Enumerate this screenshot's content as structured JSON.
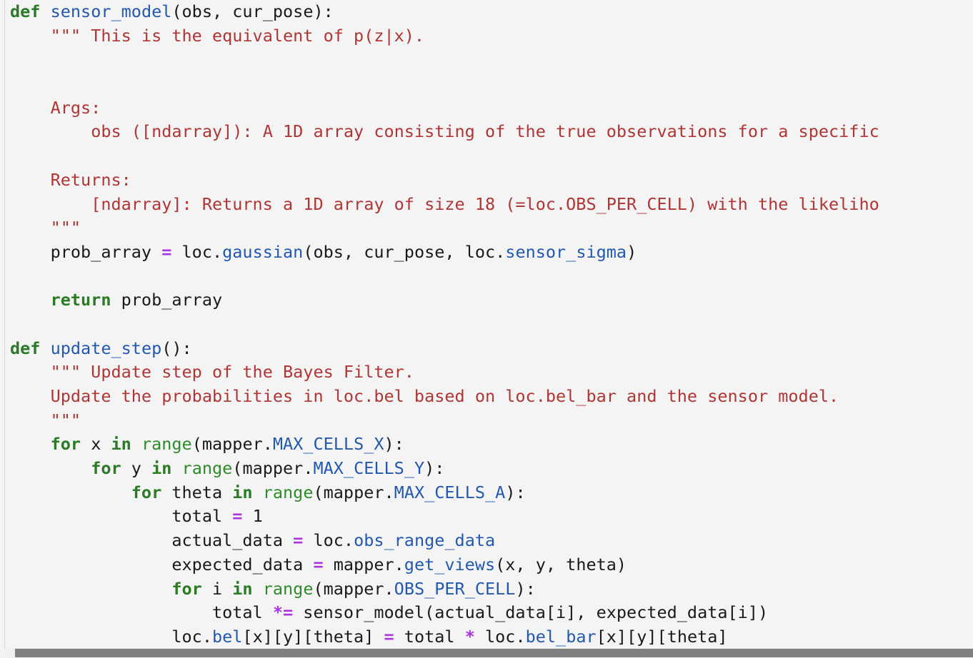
{
  "editor": {
    "language": "python",
    "background_color": "#f4f4f4",
    "text_color": "#1a1a1a",
    "colors": {
      "keyword": "#2a7a26",
      "builtin": "#2f8a2a",
      "function": "#2358b0",
      "attribute": "#2358b0",
      "string": "#b03535",
      "operator": "#aa35e0",
      "gutter_rule": "#d8d8d8",
      "scrollbar_thumb": "#808080",
      "scrollbar_track": "#f0f0f0"
    }
  },
  "scrollbar": {
    "orientation": "horizontal",
    "position": "bottom"
  },
  "code": {
    "lines": [
      {
        "indent": 0,
        "tokens": [
          {
            "t": "kw",
            "s": "def"
          },
          {
            "t": "pl",
            "s": " "
          },
          {
            "t": "fn",
            "s": "sensor_model"
          },
          {
            "t": "pl",
            "s": "(obs, cur_pose):"
          }
        ]
      },
      {
        "indent": 4,
        "tokens": [
          {
            "t": "str",
            "s": "\"\"\" This is the equivalent of p(z|x)."
          }
        ]
      },
      {
        "indent": 0,
        "tokens": []
      },
      {
        "indent": 0,
        "tokens": []
      },
      {
        "indent": 4,
        "tokens": [
          {
            "t": "str",
            "s": "Args:"
          }
        ]
      },
      {
        "indent": 8,
        "tokens": [
          {
            "t": "str",
            "s": "obs ([ndarray]): A 1D array consisting of the true observations for a specific"
          }
        ]
      },
      {
        "indent": 0,
        "tokens": []
      },
      {
        "indent": 4,
        "tokens": [
          {
            "t": "str",
            "s": "Returns:"
          }
        ]
      },
      {
        "indent": 8,
        "tokens": [
          {
            "t": "str",
            "s": "[ndarray]: Returns a 1D array of size 18 (=loc.OBS_PER_CELL) with the likeliho"
          }
        ]
      },
      {
        "indent": 4,
        "tokens": [
          {
            "t": "str",
            "s": "\"\"\""
          }
        ]
      },
      {
        "indent": 4,
        "tokens": [
          {
            "t": "pl",
            "s": "prob_array "
          },
          {
            "t": "op",
            "s": "="
          },
          {
            "t": "pl",
            "s": " loc."
          },
          {
            "t": "fn",
            "s": "gaussian"
          },
          {
            "t": "pl",
            "s": "(obs, cur_pose, loc."
          },
          {
            "t": "attr",
            "s": "sensor_sigma"
          },
          {
            "t": "pl",
            "s": ")"
          }
        ]
      },
      {
        "indent": 0,
        "tokens": []
      },
      {
        "indent": 4,
        "tokens": [
          {
            "t": "kw",
            "s": "return"
          },
          {
            "t": "pl",
            "s": " prob_array"
          }
        ]
      },
      {
        "indent": 0,
        "tokens": []
      },
      {
        "indent": 0,
        "tokens": [
          {
            "t": "kw",
            "s": "def"
          },
          {
            "t": "pl",
            "s": " "
          },
          {
            "t": "fn",
            "s": "update_step"
          },
          {
            "t": "pl",
            "s": "():"
          }
        ]
      },
      {
        "indent": 4,
        "tokens": [
          {
            "t": "str",
            "s": "\"\"\" Update step of the Bayes Filter."
          }
        ]
      },
      {
        "indent": 4,
        "tokens": [
          {
            "t": "str",
            "s": "Update the probabilities in loc.bel based on loc.bel_bar and the sensor model."
          }
        ]
      },
      {
        "indent": 4,
        "tokens": [
          {
            "t": "str",
            "s": "\"\"\""
          }
        ]
      },
      {
        "indent": 4,
        "tokens": [
          {
            "t": "kw",
            "s": "for"
          },
          {
            "t": "pl",
            "s": " x "
          },
          {
            "t": "kw",
            "s": "in"
          },
          {
            "t": "pl",
            "s": " "
          },
          {
            "t": "bi",
            "s": "range"
          },
          {
            "t": "pl",
            "s": "(mapper."
          },
          {
            "t": "attr",
            "s": "MAX_CELLS_X"
          },
          {
            "t": "pl",
            "s": "):"
          }
        ]
      },
      {
        "indent": 8,
        "tokens": [
          {
            "t": "kw",
            "s": "for"
          },
          {
            "t": "pl",
            "s": " y "
          },
          {
            "t": "kw",
            "s": "in"
          },
          {
            "t": "pl",
            "s": " "
          },
          {
            "t": "bi",
            "s": "range"
          },
          {
            "t": "pl",
            "s": "(mapper."
          },
          {
            "t": "attr",
            "s": "MAX_CELLS_Y"
          },
          {
            "t": "pl",
            "s": "):"
          }
        ]
      },
      {
        "indent": 12,
        "tokens": [
          {
            "t": "kw",
            "s": "for"
          },
          {
            "t": "pl",
            "s": " theta "
          },
          {
            "t": "kw",
            "s": "in"
          },
          {
            "t": "pl",
            "s": " "
          },
          {
            "t": "bi",
            "s": "range"
          },
          {
            "t": "pl",
            "s": "(mapper."
          },
          {
            "t": "attr",
            "s": "MAX_CELLS_A"
          },
          {
            "t": "pl",
            "s": "):"
          }
        ]
      },
      {
        "indent": 16,
        "tokens": [
          {
            "t": "pl",
            "s": "total "
          },
          {
            "t": "op",
            "s": "="
          },
          {
            "t": "pl",
            "s": " "
          },
          {
            "t": "num",
            "s": "1"
          }
        ]
      },
      {
        "indent": 16,
        "tokens": [
          {
            "t": "pl",
            "s": "actual_data "
          },
          {
            "t": "op",
            "s": "="
          },
          {
            "t": "pl",
            "s": " loc."
          },
          {
            "t": "attr",
            "s": "obs_range_data"
          }
        ]
      },
      {
        "indent": 16,
        "tokens": [
          {
            "t": "pl",
            "s": "expected_data "
          },
          {
            "t": "op",
            "s": "="
          },
          {
            "t": "pl",
            "s": " mapper."
          },
          {
            "t": "fn",
            "s": "get_views"
          },
          {
            "t": "pl",
            "s": "(x, y, theta)"
          }
        ]
      },
      {
        "indent": 16,
        "tokens": [
          {
            "t": "kw",
            "s": "for"
          },
          {
            "t": "pl",
            "s": " i "
          },
          {
            "t": "kw",
            "s": "in"
          },
          {
            "t": "pl",
            "s": " "
          },
          {
            "t": "bi",
            "s": "range"
          },
          {
            "t": "pl",
            "s": "(mapper."
          },
          {
            "t": "attr",
            "s": "OBS_PER_CELL"
          },
          {
            "t": "pl",
            "s": "):"
          }
        ]
      },
      {
        "indent": 20,
        "tokens": [
          {
            "t": "pl",
            "s": "total "
          },
          {
            "t": "op",
            "s": "*="
          },
          {
            "t": "pl",
            "s": " sensor_model(actual_data[i], expected_data[i])"
          }
        ]
      },
      {
        "indent": 16,
        "tokens": [
          {
            "t": "pl",
            "s": "loc."
          },
          {
            "t": "attr",
            "s": "bel"
          },
          {
            "t": "pl",
            "s": "[x][y][theta] "
          },
          {
            "t": "op",
            "s": "="
          },
          {
            "t": "pl",
            "s": " total "
          },
          {
            "t": "op",
            "s": "*"
          },
          {
            "t": "pl",
            "s": " loc."
          },
          {
            "t": "attr",
            "s": "bel_bar"
          },
          {
            "t": "pl",
            "s": "[x][y][theta]"
          }
        ]
      }
    ]
  }
}
